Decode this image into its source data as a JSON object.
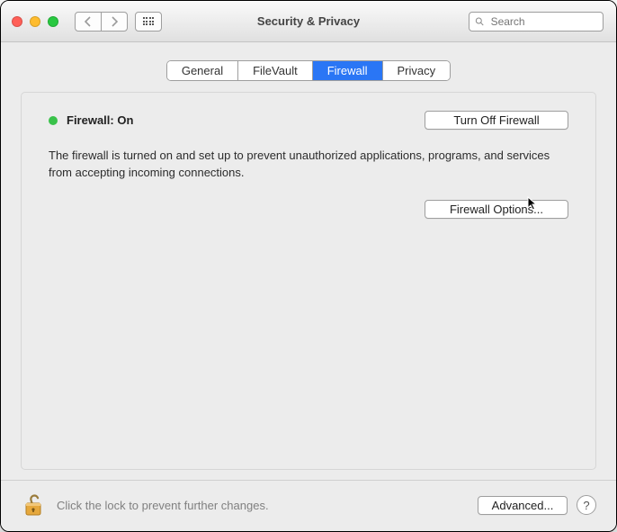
{
  "window": {
    "title": "Security & Privacy"
  },
  "search": {
    "placeholder": "Search",
    "value": ""
  },
  "tabs": [
    {
      "label": "General"
    },
    {
      "label": "FileVault"
    },
    {
      "label": "Firewall",
      "active": true
    },
    {
      "label": "Privacy"
    }
  ],
  "firewall": {
    "status_label": "Firewall: On",
    "status_on": true,
    "toggle_button": "Turn Off Firewall",
    "description": "The firewall is turned on and set up to prevent unauthorized applications, programs, and services from accepting incoming connections.",
    "options_button": "Firewall Options..."
  },
  "footer": {
    "lock_text": "Click the lock to prevent further changes.",
    "advanced_button": "Advanced...",
    "help_button": "?"
  },
  "colors": {
    "accent": "#2a76f5",
    "status_green": "#39c24a"
  }
}
